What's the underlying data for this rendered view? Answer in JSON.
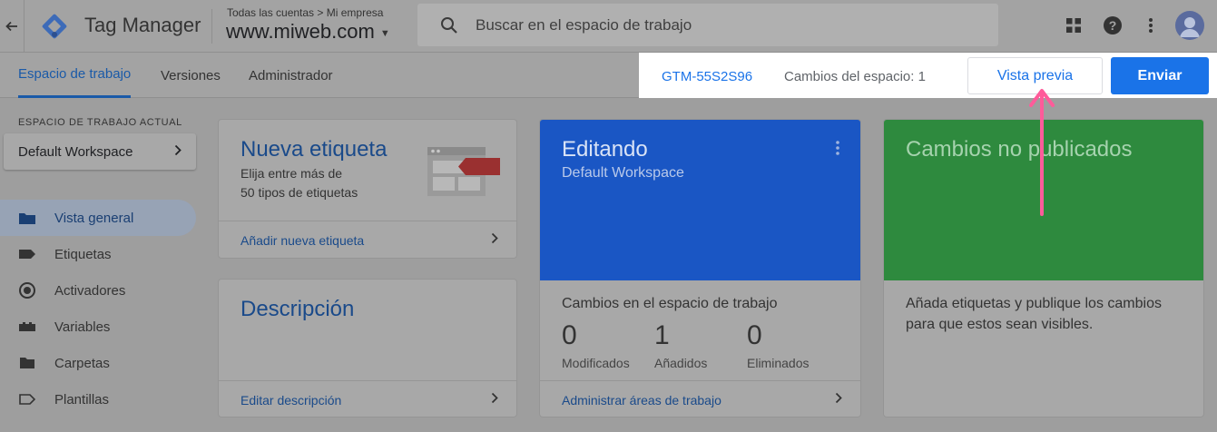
{
  "header": {
    "back_icon": "arrow-back-icon",
    "app_title": "Tag Manager",
    "breadcrumb": "Todas las cuentas > Mi empresa",
    "container_name": "www.miweb.com",
    "search_placeholder": "Buscar en el espacio de trabajo",
    "icons": [
      "apps-grid-icon",
      "help-icon",
      "more-vert-icon",
      "account-avatar"
    ]
  },
  "nav": {
    "tabs": [
      {
        "label": "Espacio de trabajo",
        "active": true
      },
      {
        "label": "Versiones",
        "active": false
      },
      {
        "label": "Administrador",
        "active": false
      }
    ],
    "container_id": "GTM-55S2S96",
    "workspace_changes": "Cambios del espacio: 1",
    "preview_label": "Vista previa",
    "submit_label": "Enviar"
  },
  "sidebar": {
    "workspace_heading": "ESPACIO DE TRABAJO ACTUAL",
    "workspace_name": "Default Workspace",
    "items": [
      {
        "label": "Vista general",
        "icon": "overview-icon",
        "active": true
      },
      {
        "label": "Etiquetas",
        "icon": "tag-icon",
        "active": false
      },
      {
        "label": "Activadores",
        "icon": "trigger-icon",
        "active": false
      },
      {
        "label": "Variables",
        "icon": "variables-icon",
        "active": false
      },
      {
        "label": "Carpetas",
        "icon": "folder-icon",
        "active": false
      },
      {
        "label": "Plantillas",
        "icon": "template-icon",
        "active": false
      }
    ]
  },
  "cards": {
    "new_tag": {
      "title": "Nueva etiqueta",
      "subtitle_line1": "Elija entre más de",
      "subtitle_line2": "50 tipos de etiquetas",
      "link": "Añadir nueva etiqueta"
    },
    "description": {
      "title": "Descripción",
      "link": "Editar descripción"
    },
    "editing": {
      "title": "Editando",
      "workspace": "Default Workspace",
      "changes_heading": "Cambios en el espacio de trabajo",
      "stats": [
        {
          "value": "0",
          "label": "Modificados"
        },
        {
          "value": "1",
          "label": "Añadidos"
        },
        {
          "value": "0",
          "label": "Eliminados"
        }
      ],
      "link": "Administrar áreas de trabajo",
      "header_color": "#1a56c4"
    },
    "unpublished": {
      "title": "Cambios no publicados",
      "body_line1": "Añada etiquetas y publique los cambios",
      "body_line2": "para que estos sean visibles.",
      "header_color": "#2e8a3e"
    }
  },
  "annotation": {
    "arrow_color": "#ff5b9a"
  }
}
